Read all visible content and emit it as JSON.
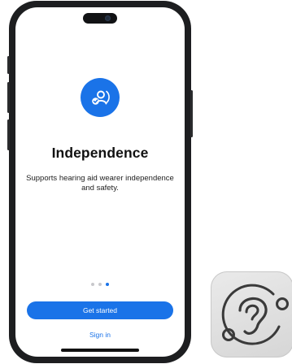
{
  "screen": {
    "title": "Independence",
    "subtitle": "Supports hearing aid wearer independence and safety.",
    "pagination": {
      "total": 3,
      "active_index": 2
    },
    "primary_button_label": "Get started",
    "secondary_link_label": "Sign in",
    "hero_icon": "person-check-icon"
  },
  "side_app_icon": {
    "icon": "ear-orbit-icon"
  },
  "colors": {
    "accent": "#1a73e8",
    "phone_frame": "#1d1e20",
    "dot_inactive": "#c8c8cc",
    "side_icon_bg": "#dcdcdc"
  }
}
